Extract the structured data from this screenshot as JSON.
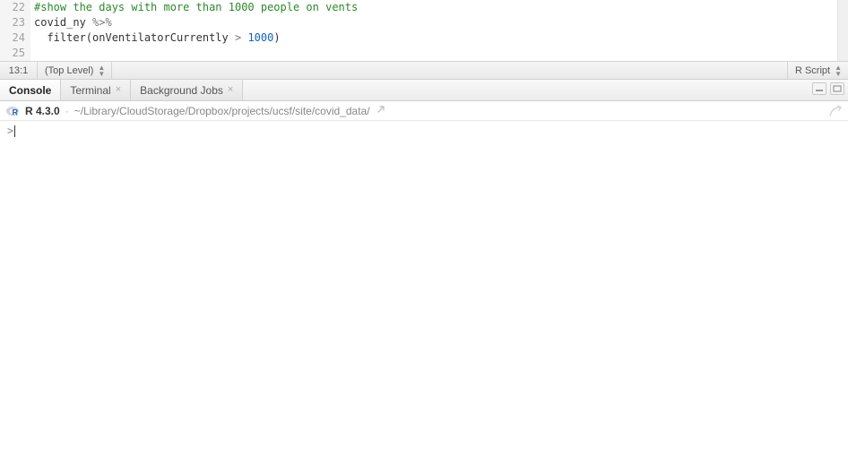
{
  "editor": {
    "lines": [
      {
        "n": 22,
        "tokens": [
          {
            "t": "#show the days with more than 1000 people on vents",
            "c": "comment"
          }
        ]
      },
      {
        "n": 23,
        "tokens": [
          {
            "t": "covid_ny ",
            "c": "text"
          },
          {
            "t": "%>%",
            "c": "op"
          }
        ]
      },
      {
        "n": 24,
        "tokens": [
          {
            "t": "  filter(onVentilatorCurrently ",
            "c": "text"
          },
          {
            "t": ">",
            "c": "op"
          },
          {
            "t": " ",
            "c": "text"
          },
          {
            "t": "1000",
            "c": "num"
          },
          {
            "t": ")",
            "c": "text"
          }
        ]
      },
      {
        "n": 25,
        "tokens": []
      }
    ]
  },
  "status": {
    "cursor": "13:1",
    "scope": "(Top Level)",
    "lang": "R Script"
  },
  "tabs": {
    "items": [
      {
        "label": "Console",
        "active": true,
        "closable": false
      },
      {
        "label": "Terminal",
        "active": false,
        "closable": true
      },
      {
        "label": "Background Jobs",
        "active": false,
        "closable": true
      }
    ]
  },
  "console": {
    "version": "R 4.3.0",
    "sep": "·",
    "path": "~/Library/CloudStorage/Dropbox/projects/ucsf/site/covid_data/",
    "prompt": ">"
  }
}
